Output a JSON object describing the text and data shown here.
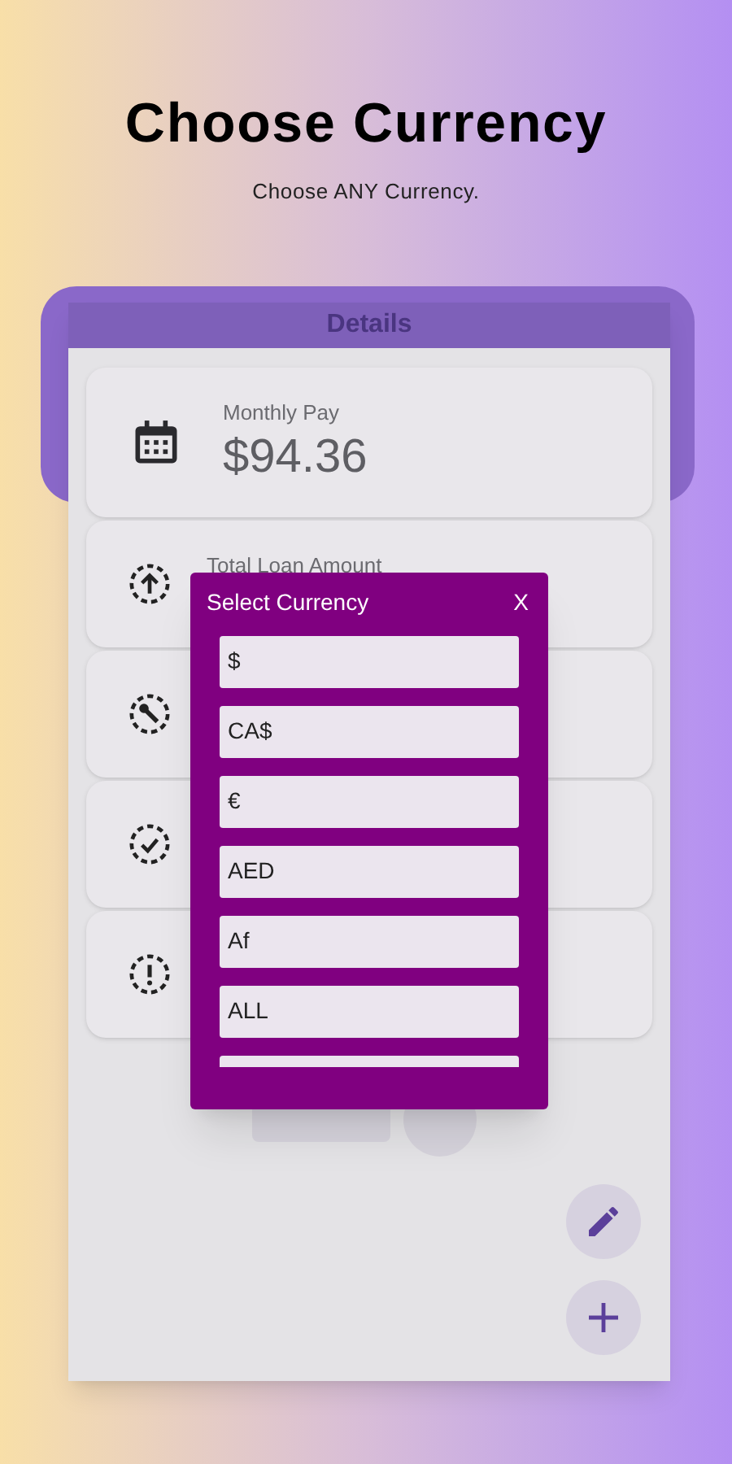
{
  "header": {
    "title": "Choose Currency",
    "subtitle": "Choose ANY Currency."
  },
  "panel": {
    "title": "Details"
  },
  "cards": [
    {
      "kind": "calendar",
      "label": "Monthly Pay",
      "value": "$94.36"
    },
    {
      "kind": "upload",
      "label": "Total Loan Amount"
    },
    {
      "kind": "wrench"
    },
    {
      "kind": "check"
    },
    {
      "kind": "alert"
    }
  ],
  "dialog": {
    "title": "Select Currency",
    "close": "X",
    "options": [
      "$",
      "CA$",
      "€",
      "AED",
      "Af",
      "ALL"
    ]
  }
}
